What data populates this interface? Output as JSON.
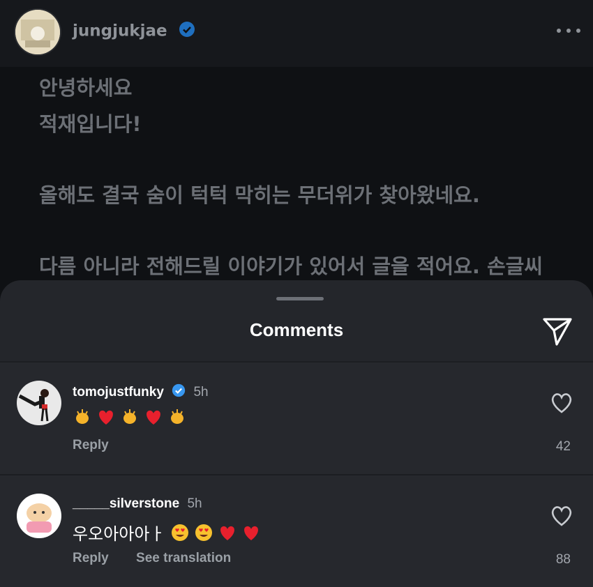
{
  "post": {
    "username": "jungjukjae",
    "lines": [
      "안녕하세요",
      "적재입니다!",
      "올해도 결국 숨이 턱턱 막히는 무더위가 찾아왔네요.",
      "다름 아니라 전해드릴 이야기가 있어서 글을 적어요. 손글씨"
    ]
  },
  "comments_sheet": {
    "title": "Comments",
    "comments": [
      {
        "username": "tomojustfunky",
        "verified": true,
        "time": "5h",
        "text": "",
        "emojis": [
          "clapping-hands",
          "red-heart",
          "clapping-hands",
          "red-heart",
          "clapping-hands"
        ],
        "reply_label": "Reply",
        "likes": "42"
      },
      {
        "username": "_____silverstone",
        "verified": false,
        "time": "5h",
        "text": "우오아아아ㅏ",
        "emojis": [
          "heart-eyes",
          "heart-eyes",
          "red-heart",
          "red-heart"
        ],
        "reply_label": "Reply",
        "translate_label": "See translation",
        "likes": "88"
      }
    ]
  },
  "colors": {
    "background": "#0f1114",
    "sheet": "#24262b",
    "verified": "#3897f0",
    "heart": "#e8202d"
  }
}
